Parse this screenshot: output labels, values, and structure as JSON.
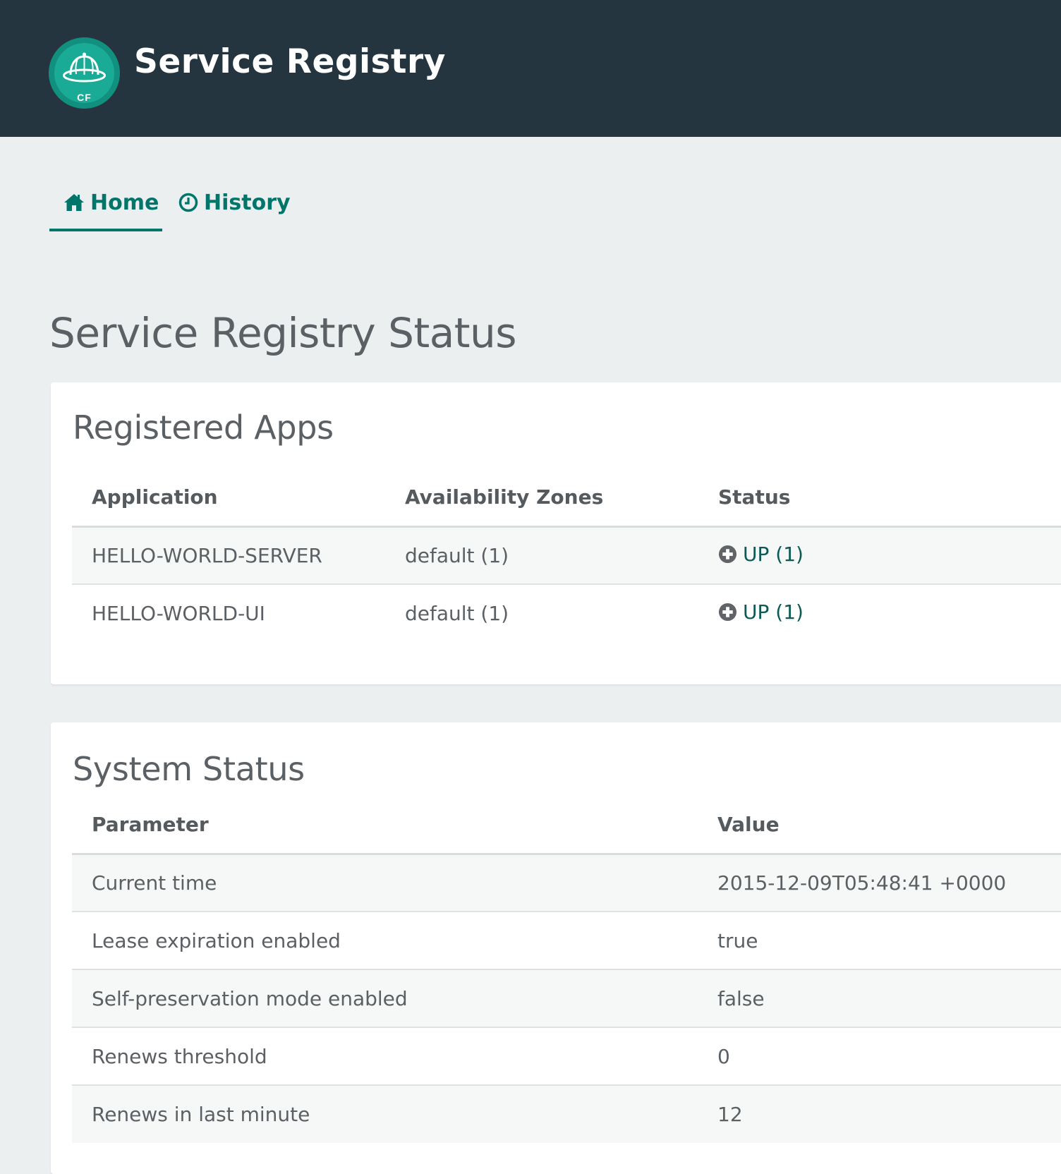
{
  "header": {
    "logo_text": "CF",
    "title": "Service Registry"
  },
  "nav": {
    "tabs": [
      {
        "label": "Home",
        "icon": "home-icon",
        "active": true
      },
      {
        "label": "History",
        "icon": "clock-icon",
        "active": false
      }
    ]
  },
  "page": {
    "title": "Service Registry Status"
  },
  "registered_apps": {
    "title": "Registered Apps",
    "columns": [
      "Application",
      "Availability Zones",
      "Status"
    ],
    "rows": [
      {
        "application": "HELLO-WORLD-SERVER",
        "zones": "default (1)",
        "status": "UP (1)",
        "status_icon": "plus-circle-icon"
      },
      {
        "application": "HELLO-WORLD-UI",
        "zones": "default (1)",
        "status": "UP (1)",
        "status_icon": "plus-circle-icon"
      }
    ]
  },
  "system_status": {
    "title": "System Status",
    "columns": [
      "Parameter",
      "Value"
    ],
    "rows": [
      {
        "parameter": "Current time",
        "value": "2015-12-09T05:48:41 +0000"
      },
      {
        "parameter": "Lease expiration enabled",
        "value": "true"
      },
      {
        "parameter": "Self-preservation mode enabled",
        "value": "false"
      },
      {
        "parameter": "Renews threshold",
        "value": "0"
      },
      {
        "parameter": "Renews in last minute",
        "value": "12"
      }
    ]
  },
  "colors": {
    "header_bg": "#243540",
    "page_bg": "#ebeff0",
    "accent": "#00766a",
    "logo": "#1aab97"
  }
}
